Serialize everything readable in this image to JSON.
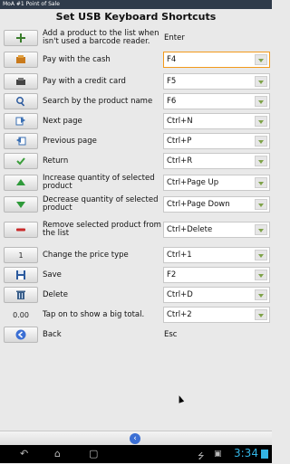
{
  "window": {
    "title": "MoA #1 Point of Sale"
  },
  "heading": "Set USB Keyboard Shortcuts",
  "rows": [
    {
      "label": "Add a product to the list when isn't used a barcode reader.",
      "value": "Enter",
      "control": "text",
      "icon": "plus-icon"
    },
    {
      "label": "Pay with the cash",
      "value": "F4",
      "control": "select",
      "selected": true,
      "icon": "cash-icon"
    },
    {
      "label": "Pay with a credit card",
      "value": "F5",
      "control": "select",
      "icon": "credit-card-icon"
    },
    {
      "label": "Search by the product name",
      "value": "F6",
      "control": "select",
      "icon": "magnifier-icon"
    },
    {
      "label": "Next page",
      "value": "Ctrl+N",
      "control": "select",
      "icon": "next-page-icon"
    },
    {
      "label": "Previous page",
      "value": "Ctrl+P",
      "control": "select",
      "icon": "previous-page-icon"
    },
    {
      "label": "Return",
      "value": "Ctrl+R",
      "control": "select",
      "icon": "checkmark-icon"
    },
    {
      "label": "Increase quantity of selected product",
      "value": "Ctrl+Page Up",
      "control": "select",
      "icon": "triangle-up-icon"
    },
    {
      "label": "Decrease quantity of selected product",
      "value": "Ctrl+Page Down",
      "control": "select",
      "icon": "triangle-down-icon"
    },
    {
      "label": "Remove selected product from the list",
      "value": "Ctrl+Delete",
      "control": "select",
      "icon": "minus-icon"
    },
    {
      "label": "Change the price type",
      "value": "Ctrl+1",
      "control": "select",
      "icon_text": "1",
      "icon": "number-one-icon"
    },
    {
      "label": "Save",
      "value": "F2",
      "control": "select",
      "icon": "floppy-disk-icon"
    },
    {
      "label": "Delete",
      "value": "Ctrl+D",
      "control": "select",
      "icon": "trash-icon"
    },
    {
      "label": "Tap on to show a big total.",
      "value": "Ctrl+2",
      "control": "select",
      "icon_text": "0.00",
      "icon": "total-amount-icon"
    },
    {
      "label": "Back",
      "value": "Esc",
      "control": "text",
      "icon": "back-arrow-icon"
    }
  ],
  "system": {
    "clock": "3:34"
  },
  "colors": {
    "accent_selected": "#f29a1c",
    "dropdown_arrow": "#7fa34a",
    "clock": "#33b5e5"
  }
}
